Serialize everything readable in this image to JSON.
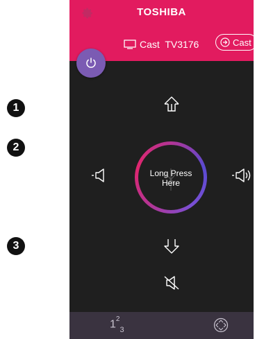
{
  "header": {
    "brand": "TOSHIBA",
    "settings_icon": "gear-icon"
  },
  "cast_bar": {
    "device_name": "Cast  TV3176",
    "device_icon": "tv-icon",
    "cast_label": "Cast",
    "cast_icon": "cast-icon"
  },
  "power": {
    "icon": "power-icon"
  },
  "remote": {
    "center_label_line1": "Long Press",
    "center_label_line2": "Here",
    "up_icon": "arrow-up-icon",
    "down_icon": "arrow-down-icon",
    "vol_down_icon": "volume-down-icon",
    "vol_up_icon": "volume-up-icon",
    "mute_icon": "mute-icon"
  },
  "bottom_bar": {
    "numpad_base": "1",
    "numpad_sup": "2",
    "numpad_sub": "3",
    "nav_icon": "directional-pad-icon"
  },
  "callouts": [
    "1",
    "2",
    "3"
  ],
  "colors": {
    "brand": "#e21b5f",
    "power": "#7b5bb3",
    "background": "#1f1f1f",
    "bottom_bar": "#3a3340"
  }
}
